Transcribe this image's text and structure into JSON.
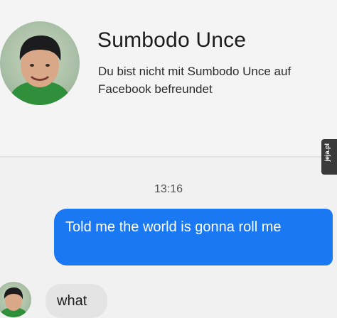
{
  "profile": {
    "name": "Sumbodo Unce",
    "subtitle": "Du bist nicht mit Sumbodo Unce auf Facebook befreundet"
  },
  "watermark": {
    "text": "jeja.pl"
  },
  "conversation": {
    "timestamp": "13:16",
    "messages": [
      {
        "direction": "sent",
        "text": "Told me the world is gonna roll me"
      },
      {
        "direction": "received",
        "text": "what"
      }
    ]
  },
  "colors": {
    "sent_bubble": "#1a78f2",
    "received_bubble": "#e4e4e4",
    "background": "#f1f1f1"
  }
}
